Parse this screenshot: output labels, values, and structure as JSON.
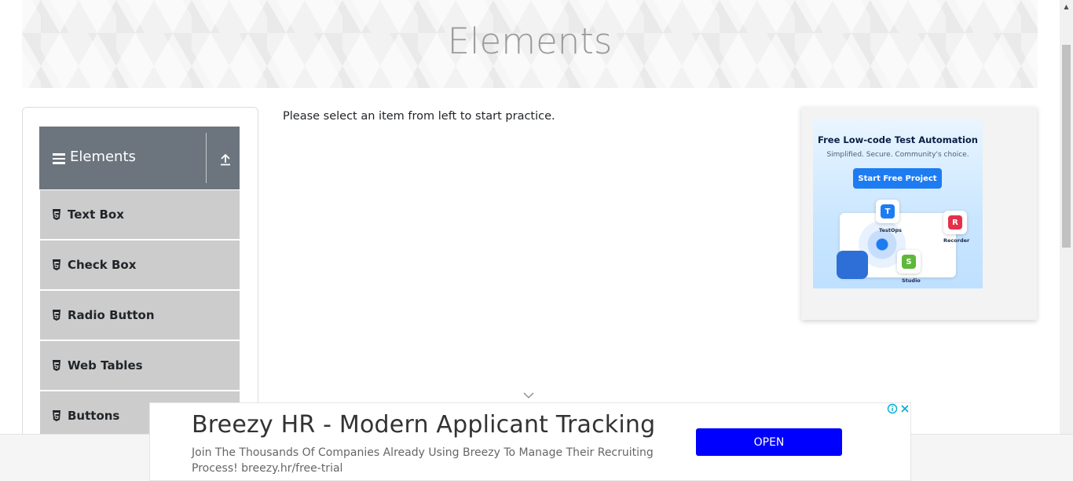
{
  "header": {
    "title": "Elements"
  },
  "sidebar": {
    "group_title": "Elements",
    "items": [
      {
        "label": "Text Box"
      },
      {
        "label": "Check Box"
      },
      {
        "label": "Radio Button"
      },
      {
        "label": "Web Tables"
      },
      {
        "label": "Buttons"
      }
    ]
  },
  "main": {
    "message": "Please select an item from left to start practice."
  },
  "side_ad": {
    "title": "Free Low-code Test Automation",
    "subtitle": "Simplified. Secure. Community's choice.",
    "button_label": "Start Free Project",
    "tiles": [
      {
        "label": "TestOps",
        "letter": "T",
        "color": "#1e7cf2"
      },
      {
        "label": "Recorder",
        "letter": "R",
        "color": "#e5304a"
      },
      {
        "label": "Studio",
        "letter": "S",
        "color": "#5fb83a"
      }
    ]
  },
  "bottom_ad": {
    "headline": "Breezy HR - Modern Applicant Tracking",
    "description": "Join The Thousands Of Companies Already Using Breezy To Manage Their Recruiting Process! breezy.hr/free-trial",
    "button_label": "OPEN"
  },
  "colors": {
    "sidebar_header": "#6c757d",
    "menu_item": "#cccccc",
    "open_button": "#0000ff"
  }
}
